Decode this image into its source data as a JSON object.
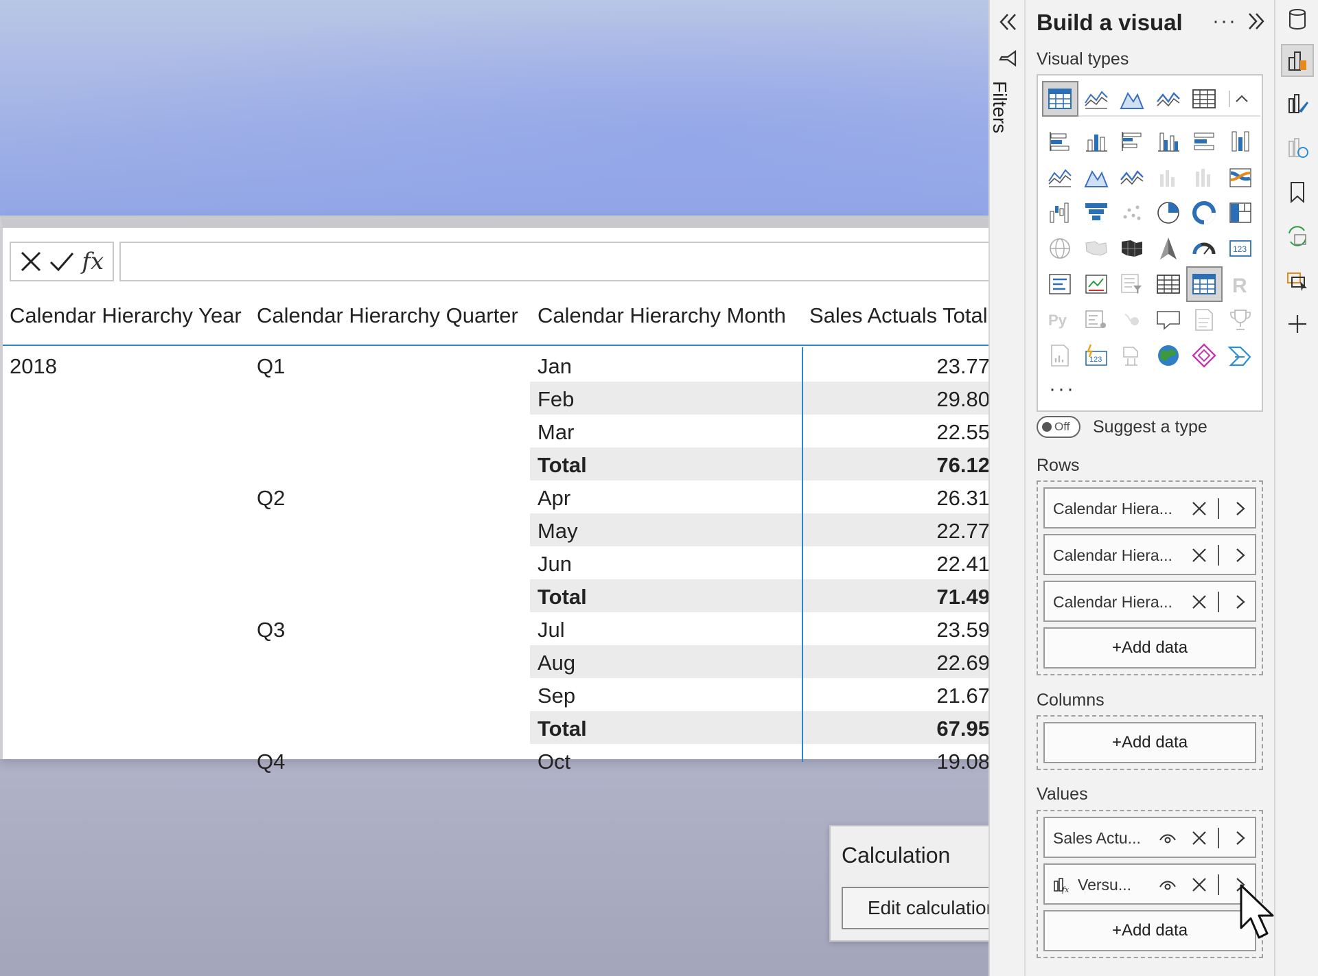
{
  "formula_bar": {
    "cancel_icon": "close-icon",
    "commit_icon": "check-icon",
    "fx_label": "fx",
    "value": ""
  },
  "table": {
    "headers": {
      "year": "Calendar Hierarchy Year",
      "quarter": "Calendar Hierarchy Quarter",
      "month": "Calendar Hierarchy Month",
      "sales": "Sales Actuals Total"
    },
    "rows": [
      {
        "year": "2018",
        "quarter": "Q1",
        "month": "Jan",
        "value": "23.77"
      },
      {
        "year": "",
        "quarter": "",
        "month": "Feb",
        "value": "29.80"
      },
      {
        "year": "",
        "quarter": "",
        "month": "Mar",
        "value": "22.55"
      },
      {
        "year": "",
        "quarter": "",
        "month": "Total",
        "value": "76.12"
      },
      {
        "year": "",
        "quarter": "Q2",
        "month": "Apr",
        "value": "26.31"
      },
      {
        "year": "",
        "quarter": "",
        "month": "May",
        "value": "22.77"
      },
      {
        "year": "",
        "quarter": "",
        "month": "Jun",
        "value": "22.41"
      },
      {
        "year": "",
        "quarter": "",
        "month": "Total",
        "value": "71.49"
      },
      {
        "year": "",
        "quarter": "Q3",
        "month": "Jul",
        "value": "23.59"
      },
      {
        "year": "",
        "quarter": "",
        "month": "Aug",
        "value": "22.69"
      },
      {
        "year": "",
        "quarter": "",
        "month": "Sep",
        "value": "21.67"
      },
      {
        "year": "",
        "quarter": "",
        "month": "Total",
        "value": "67.95"
      },
      {
        "year": "",
        "quarter": "Q4",
        "month": "Oct",
        "value": "19.08"
      }
    ]
  },
  "calculation_popup": {
    "title": "Calculation",
    "edit_button": "Edit calculation"
  },
  "filters": {
    "label": "Filters"
  },
  "pane": {
    "title": "Build a visual",
    "more": "···",
    "visual_types_label": "Visual types",
    "more_visuals": "···",
    "suggest_toggle_state": "Off",
    "suggest_label": "Suggest a type",
    "rows_label": "Rows",
    "rows_fields": [
      "Calendar Hiera...",
      "Calendar Hiera...",
      "Calendar Hiera..."
    ],
    "columns_label": "Columns",
    "values_label": "Values",
    "values_fields": [
      "Sales Actu...",
      "Versu..."
    ],
    "add_data": "+Add data"
  },
  "colors": {
    "accent_blue": "#2a86c9",
    "row_shade": "#ebebeb",
    "pane_bg": "#f2f2f2"
  }
}
